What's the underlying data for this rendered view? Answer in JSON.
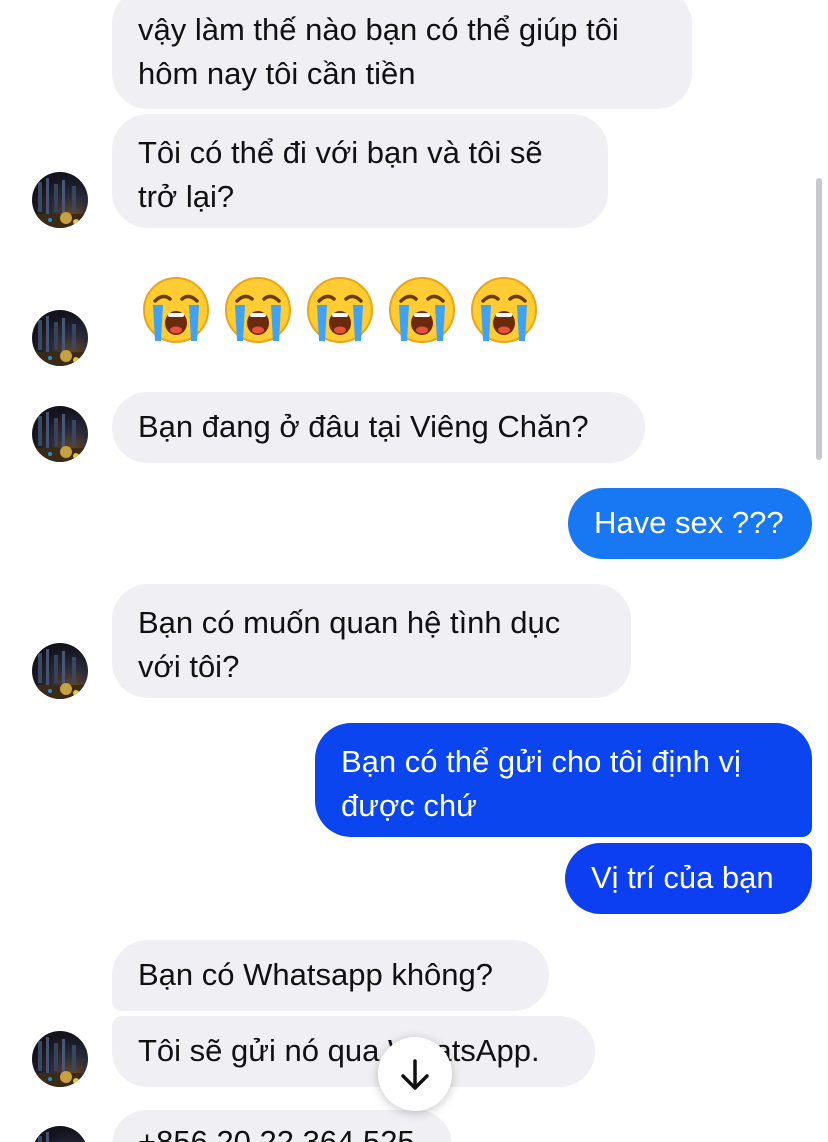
{
  "messages": {
    "m1": [
      "vậy làm thế nào bạn có thể giúp tôi",
      "hôm nay tôi cần tiền"
    ],
    "m2": [
      "Tôi có thể đi với bạn và tôi sẽ",
      "trở lại?"
    ],
    "reaction_emoji": [
      "😭",
      "😭",
      "😭",
      "😭",
      "😭"
    ],
    "m3": "Bạn đang ở đâu tại Viêng Chăn?",
    "m4": "Have sex ???",
    "m5": [
      "Bạn có muốn quan hệ tình dục",
      "với tôi?"
    ],
    "m6": [
      "Bạn có thể gửi cho tôi định vị",
      "được chứ"
    ],
    "m7": "Vị trí của bạn",
    "m8": "Bạn có Whatsapp không?",
    "m9": "Tôi sẽ gửi nó qua WhatsApp.",
    "m10_partial": "+856 20 22 364 525"
  },
  "icons": {
    "avatar": "contact-avatar-photo",
    "emoji": "loudly-crying-face",
    "scroll_down": "arrow-down-icon"
  },
  "colors": {
    "incoming_bubble": "#efeff4",
    "outgoing_light": "#1877f2",
    "outgoing_mid": "#0a45f0",
    "outgoing_dark": "#0c3ff1",
    "text": "#111111"
  }
}
